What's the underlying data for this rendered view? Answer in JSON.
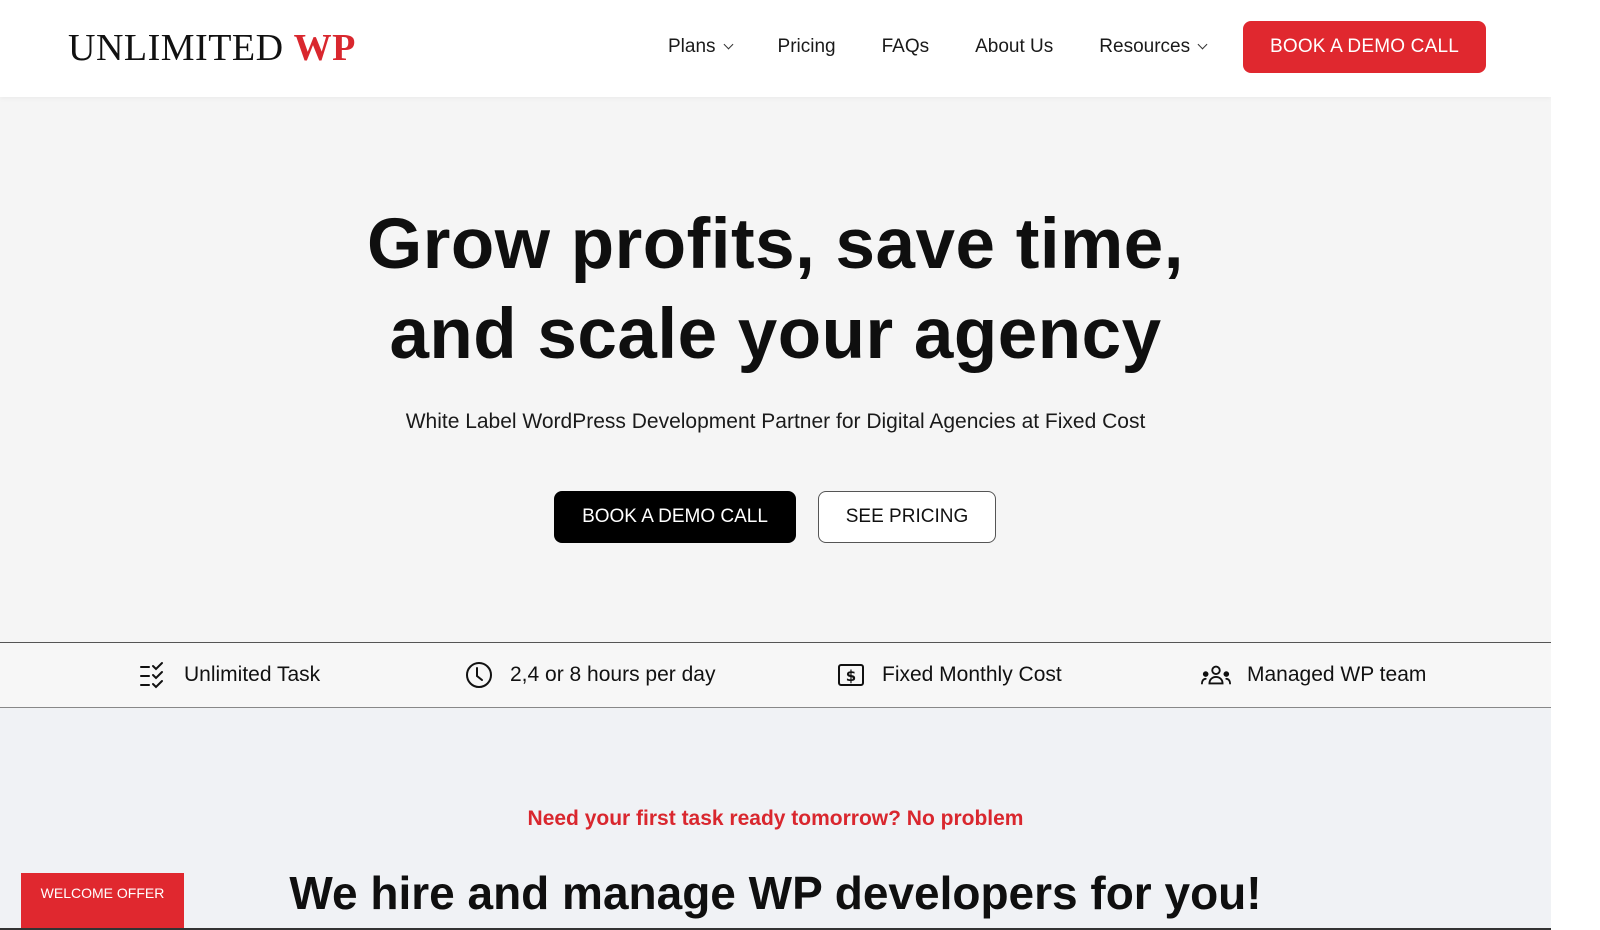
{
  "header": {
    "logo_main": "UNLIMITED",
    "logo_accent": "WP",
    "nav": [
      {
        "label": "Plans",
        "has_dropdown": true
      },
      {
        "label": "Pricing",
        "has_dropdown": false
      },
      {
        "label": "FAQs",
        "has_dropdown": false
      },
      {
        "label": "About Us",
        "has_dropdown": false
      },
      {
        "label": "Resources",
        "has_dropdown": true
      }
    ],
    "cta_label": "BOOK A DEMO CALL"
  },
  "hero": {
    "title_line1": "Grow profits, save time,",
    "title_line2": "and scale your agency",
    "subtitle": "White Label WordPress Development Partner for Digital Agencies at Fixed Cost",
    "primary_button": "BOOK A DEMO CALL",
    "secondary_button": "SEE PRICING"
  },
  "features": [
    {
      "icon": "checklist-icon",
      "label": "Unlimited Task"
    },
    {
      "icon": "clock-icon",
      "label": "2,4 or 8 hours per day"
    },
    {
      "icon": "dollar-bill-icon",
      "label": "Fixed Monthly Cost"
    },
    {
      "icon": "team-icon",
      "label": "Managed WP team"
    }
  ],
  "section2": {
    "eyebrow": "Need your first task ready tomorrow? No problem",
    "title": "We hire and manage WP developers for you!"
  },
  "welcome_offer": {
    "label": "WELCOME OFFER"
  },
  "colors": {
    "accent": "#e0282f",
    "text": "#111111",
    "hero_bg": "#f5f5f5",
    "section_bg": "#f0f2f5"
  }
}
